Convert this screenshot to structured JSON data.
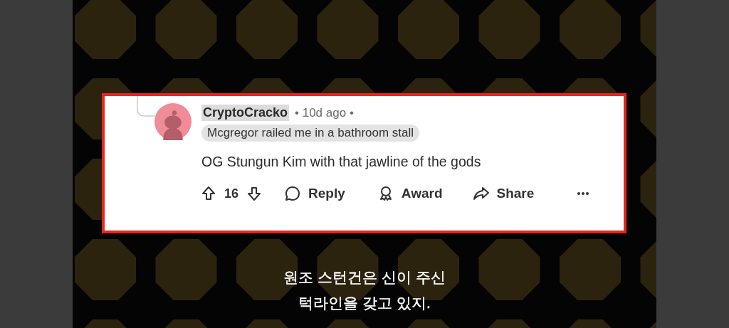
{
  "comment": {
    "author": "CryptoCracko",
    "author_highlighted": true,
    "timestamp": "• 10d ago •",
    "flair": "Mcgregor railed me in a bathroom stall",
    "body": "OG Stungun Kim with that jawline of the gods",
    "score": "16",
    "actions": [
      {
        "kind": "reply",
        "label": "Reply"
      },
      {
        "kind": "award",
        "label": "Award"
      },
      {
        "kind": "share",
        "label": "Share"
      },
      {
        "kind": "more"
      }
    ]
  },
  "subtitles": [
    "원조 스턴건은 신이 주신",
    "턱라인을 갖고 있지."
  ]
}
